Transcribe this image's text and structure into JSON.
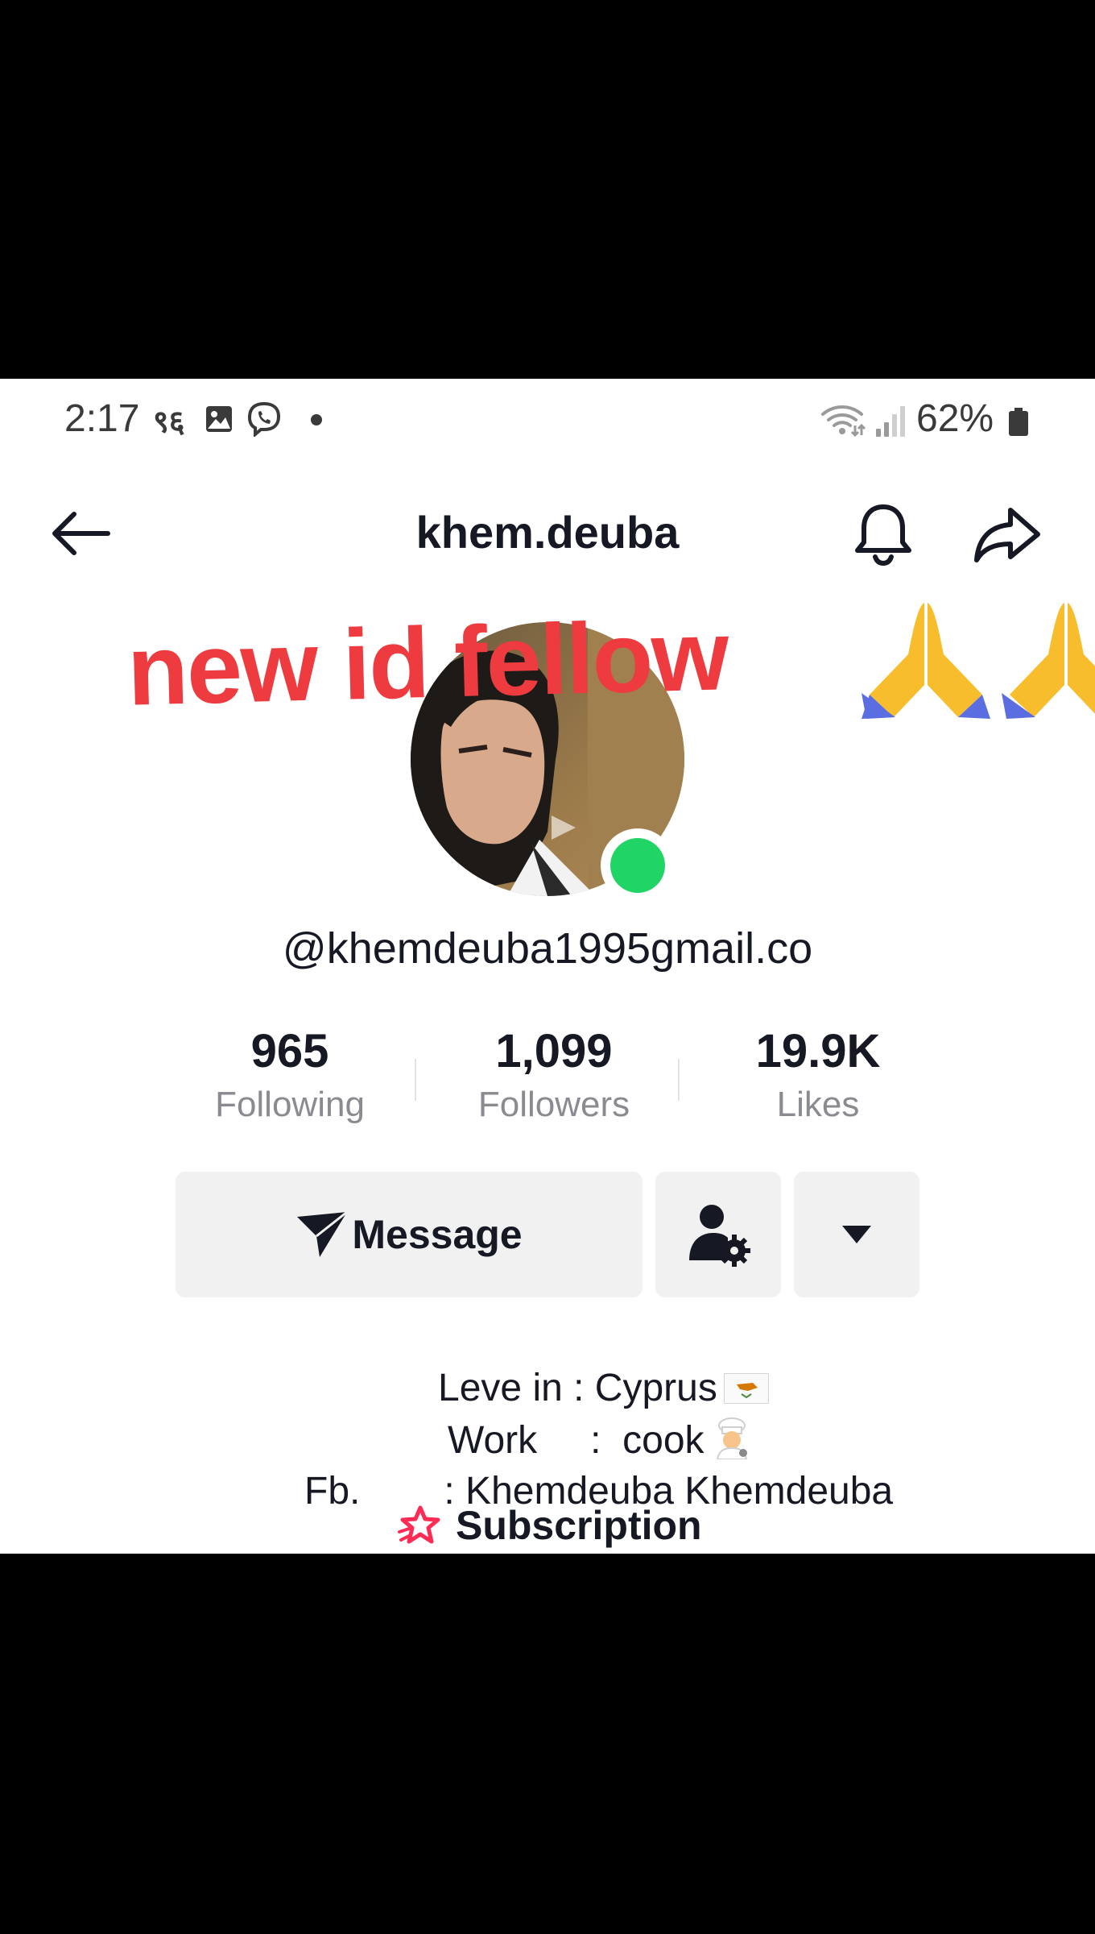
{
  "status_bar": {
    "time": "2:17",
    "extra_text": "९६",
    "battery_percent": "62%",
    "icons": [
      "gallery-icon",
      "viber-icon",
      "dot-icon",
      "wifi-icon",
      "signal-icon",
      "battery-icon"
    ]
  },
  "header": {
    "title": "khem.deuba",
    "icons": [
      "back-arrow-icon",
      "bell-icon",
      "share-icon"
    ]
  },
  "overlay": {
    "caption": "new id fellow",
    "emoji_icons": [
      "praying-hands-icon",
      "praying-hands-icon"
    ]
  },
  "profile": {
    "username": "@khemdeuba1995gmail.co",
    "online_color": "#20d565"
  },
  "stats": [
    {
      "value": "965",
      "label": "Following"
    },
    {
      "value": "1,099",
      "label": "Followers"
    },
    {
      "value": "19.9K",
      "label": "Likes"
    }
  ],
  "actions": {
    "message_label": "Message",
    "icons": [
      "send-icon",
      "person-settings-icon",
      "caret-down-icon"
    ]
  },
  "bio": {
    "line1": "Leve in : Cyprus",
    "line2_key": "Work",
    "line2_value": ":  cook",
    "line3_key": "Fb.",
    "line3_value": ": Khemdeuba Khemdeuba"
  },
  "subscription": {
    "label": "Subscription",
    "icon": "subscription-star-icon",
    "accent": "#fe2c55"
  }
}
